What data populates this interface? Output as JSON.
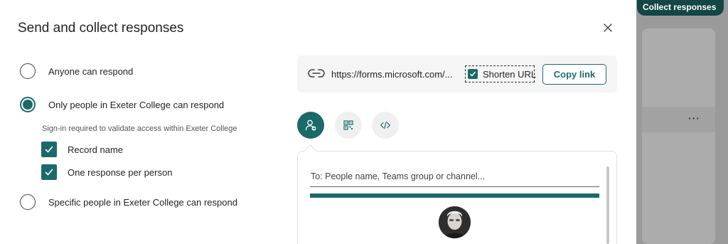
{
  "background": {
    "collect_label": "Collect responses",
    "more_label": "···"
  },
  "dialog": {
    "title": "Send and collect responses",
    "close_icon": "close-icon",
    "options": [
      {
        "label": "Anyone can respond",
        "selected": false
      },
      {
        "label": "Only people in Exeter College can respond",
        "selected": true
      },
      {
        "label": "Specific people in Exeter College can respond",
        "selected": false
      }
    ],
    "hint": "Sign-in required to validate access within Exeter College",
    "checkboxes": [
      {
        "label": "Record name",
        "checked": true
      },
      {
        "label": "One response per person",
        "checked": true
      }
    ],
    "link": {
      "icon": "link-icon",
      "url": "https://forms.microsoft.com/...",
      "shorten_label": "Shorten URL",
      "shorten_checked": true,
      "copy_label": "Copy link"
    },
    "share_methods": [
      {
        "icon": "invite-people-icon",
        "active": true
      },
      {
        "icon": "qr-code-icon",
        "active": false
      },
      {
        "icon": "embed-code-icon",
        "active": false
      }
    ],
    "invite": {
      "to_placeholder": "To: People name, Teams group or channel..."
    }
  },
  "colors": {
    "accent": "#1b6a6a",
    "dark_accent": "#144646",
    "overlay": "#9a9a9a"
  }
}
